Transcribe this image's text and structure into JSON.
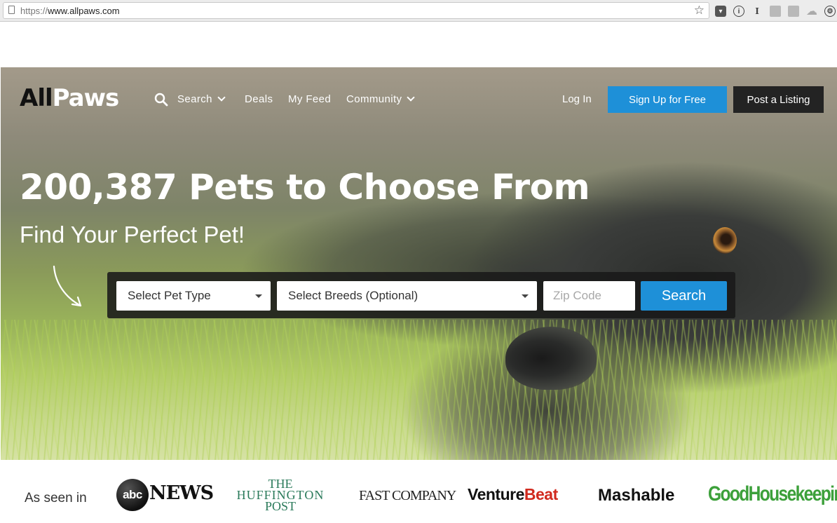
{
  "browser": {
    "url_protocol": "https://",
    "url_host": "www.allpaws.com",
    "extensions": [
      "pocket-icon",
      "info-icon",
      "cursor-icon",
      "image-icon",
      "image-icon",
      "cloud-icon",
      "settings-icon"
    ]
  },
  "nav": {
    "logo_all": "All",
    "logo_paws": "Paws",
    "search_label": "Search",
    "deals_label": "Deals",
    "feed_label": "My Feed",
    "community_label": "Community",
    "login_label": "Log In",
    "signup_label": "Sign Up for Free",
    "post_label": "Post a Listing"
  },
  "hero": {
    "headline": "200,387 Pets to Choose From",
    "subheadline": "Find Your Perfect Pet!"
  },
  "search_form": {
    "pet_type": "Select Pet Type",
    "breeds": "Select Breeds (Optional)",
    "zip_placeholder": "Zip Code",
    "search_label": "Search"
  },
  "press": {
    "label": "As seen in",
    "abc": "abc",
    "abc_news": "NEWS",
    "huff_line1": "THE",
    "huff_line2": "HUFFINGTON",
    "huff_line3": "POST",
    "fast_company": "FAST COMPANY",
    "venture": "Venture",
    "beat": "Beat",
    "mashable": "Mashable",
    "good_housekeeping": "GoodHousekeeping"
  },
  "colors": {
    "accent": "#1e90d8",
    "dark_button": "#232323",
    "beat_red": "#d12a1e",
    "gh_green": "#3ca03a"
  }
}
